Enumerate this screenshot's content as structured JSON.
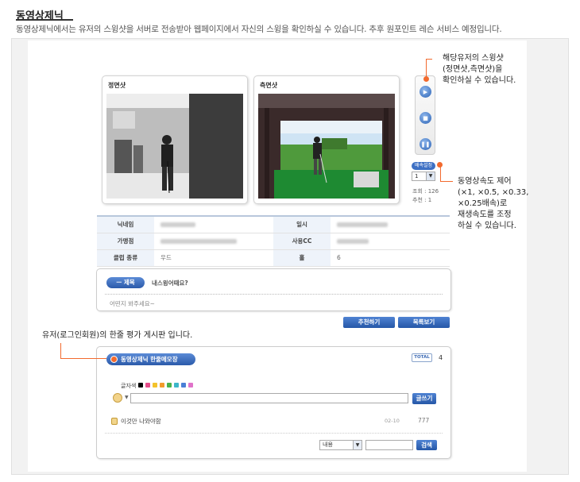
{
  "page": {
    "title": "동영상제닉",
    "description": "동영상제닉에서는 유저의 스윙샷을 서버로 전송받아 웹페이지에서 자신의 스윙을 확인하실 수 있습니다. 추후 원포인트 레슨 서비스 예정입니다."
  },
  "videos": {
    "front_label": "정면샷",
    "side_label": "측면샷"
  },
  "player": {
    "speed_label": "배속설정",
    "speed_value": "1",
    "views": "조회 : 126",
    "recommend": "추천 : 1"
  },
  "info": {
    "nickname_label": "닉네임",
    "date_label": "일시",
    "store_label": "가맹점",
    "course_label": "사용CC",
    "club_label": "클럽 종류",
    "club_value": "우드",
    "hole_label": "홀",
    "hole_value": "6"
  },
  "subject": {
    "badge": "ㅡ 제목",
    "title": "내스윙어때요?",
    "body": "어떤지 봐주세요~"
  },
  "actions": {
    "recommend_button": "추천하기",
    "list_button": "목록보기"
  },
  "board": {
    "title": "동영상제닉 한줄메모장",
    "total_label": "TOTAL",
    "total_count": "4",
    "color_label": "글자색",
    "write_button": "글쓰기",
    "comment_text": "이것만 나와야함",
    "comment_date": "02-10",
    "comment_count": "777",
    "search_option": "내용",
    "search_button": "검색",
    "swatches": [
      "#000000",
      "#e54c8a",
      "#f3c22b",
      "#f39b2b",
      "#4bb14b",
      "#3cb6c9",
      "#4a7fd6",
      "#e073c9"
    ]
  },
  "callouts": {
    "swing_line1": "해당유저의 스윙샷",
    "swing_line2": "(정면샷,측면샷)을",
    "swing_line3": "확인하실 수 있습니다.",
    "speed_line1": "동영상속도 제어",
    "speed_line2": "(×1, ×0.5, ×0.33,",
    "speed_line3": "×0.25배속)로",
    "speed_line4": "재생속도를 조정",
    "speed_line5": "하실 수 있습니다.",
    "board_note": "유저(로그인회원)의 한줄 평가 게시판 입니다."
  },
  "colors": {
    "accent_orange": "#f26a2e",
    "button_blue": "#2b5aaa",
    "table_key_bg": "#eef3fa"
  }
}
